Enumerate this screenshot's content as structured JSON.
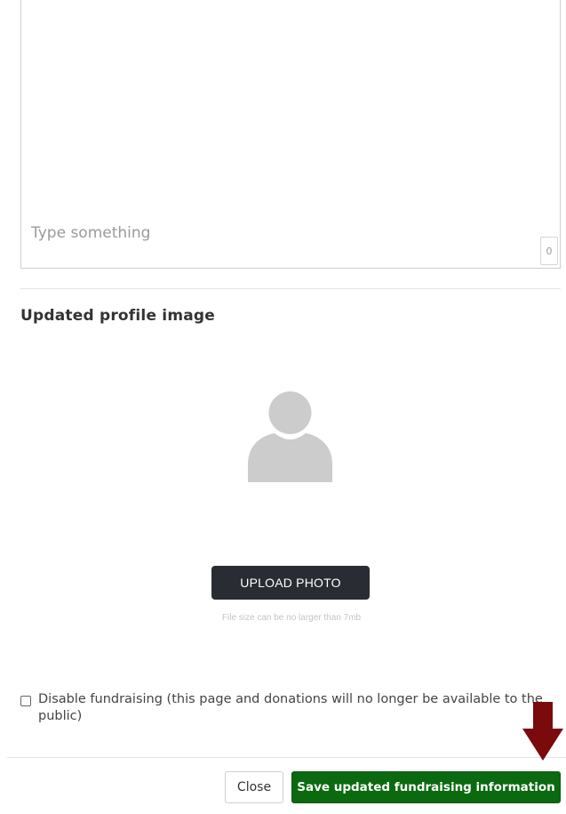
{
  "bio_editor": {
    "placeholder": "Type something",
    "char_count": "0"
  },
  "profile_image": {
    "section_title": "Updated profile image",
    "avatar_icon": "user-silhouette-icon",
    "upload_label": "UPLOAD PHOTO",
    "file_size_note": "File size can be no larger than 7mb"
  },
  "options": {
    "disable_fundraising_label": "Disable fundraising (this page and donations will no longer be available to the public)",
    "disable_fundraising_checked": false
  },
  "annotation": {
    "arrow_icon": "down-arrow-icon",
    "arrow_color": "#7b0a0d"
  },
  "footer": {
    "close_label": "Close",
    "save_label": "Save updated fundraising information",
    "save_color": "#0b6a10"
  }
}
